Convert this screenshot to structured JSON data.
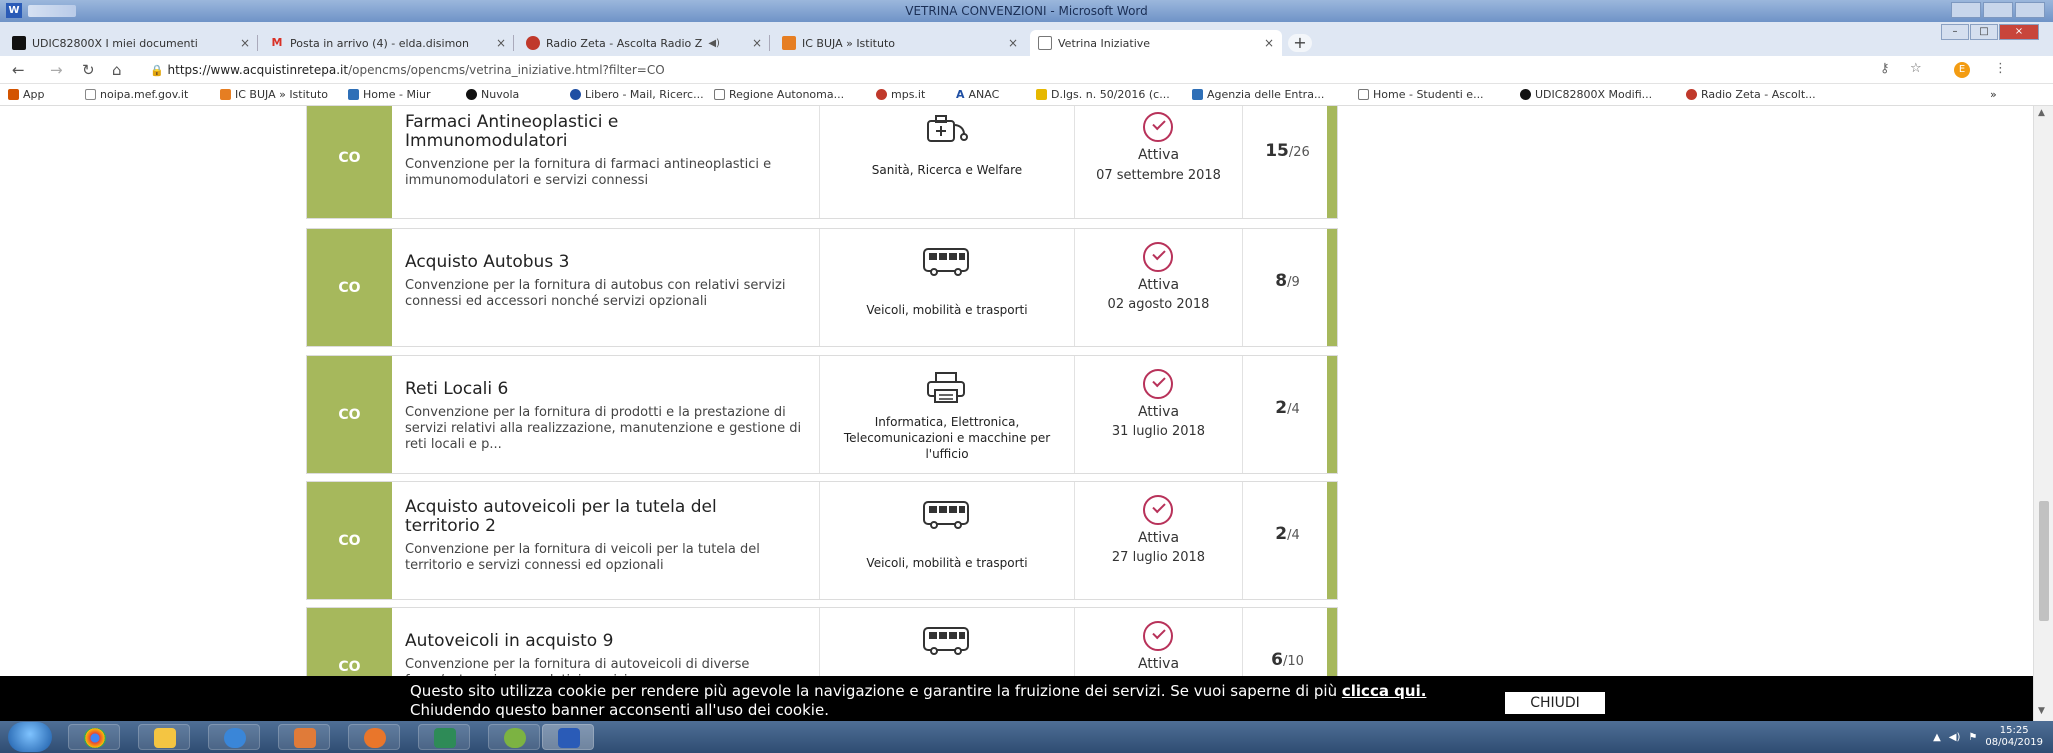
{
  "word": {
    "title": "VETRINA CONVENZIONI - Microsoft Word"
  },
  "tabs": [
    {
      "label": "UDIC82800X I miei documenti",
      "color": "#111111"
    },
    {
      "label": "Posta in arrivo (4) - elda.disimon",
      "color": "#d93025"
    },
    {
      "label": "Radio Zeta - Ascolta Radio Z",
      "color": "#c0392b"
    },
    {
      "label": "IC BUJA » Istituto",
      "color": "#e67e22"
    },
    {
      "label": "Vetrina Iniziative",
      "color": "#777777"
    }
  ],
  "address": {
    "domain": "https://www.acquistinretepa.it",
    "path": "/opencms/opencms/vetrina_iniziative.html?filter=CO"
  },
  "bookmarks": [
    {
      "label": "App",
      "color": "#d35400"
    },
    {
      "label": "noipa.mef.gov.it",
      "color": "#888888"
    },
    {
      "label": "IC BUJA » Istituto",
      "color": "#e67e22"
    },
    {
      "label": "Home - Miur",
      "color": "#2e6fb7"
    },
    {
      "label": "Nuvola",
      "color": "#111111"
    },
    {
      "label": "Libero - Mail, Ricerc...",
      "color": "#1f4fa3"
    },
    {
      "label": "Regione Autonoma...",
      "color": "#777777"
    },
    {
      "label": "mps.it",
      "color": "#c0392b"
    },
    {
      "label": "ANAC",
      "color": "#1f4fa3"
    },
    {
      "label": "D.lgs. n. 50/2016 (c...",
      "color": "#e6b800"
    },
    {
      "label": "Agenzia delle Entra...",
      "color": "#2e6fb7"
    },
    {
      "label": "Home - Studenti e...",
      "color": "#777777"
    },
    {
      "label": "UDIC82800X Modifi...",
      "color": "#111111"
    },
    {
      "label": "Radio Zeta - Ascolt...",
      "color": "#c0392b"
    }
  ],
  "initiatives": [
    {
      "code": "CO",
      "title": "Farmaci Antineoplastici e Immunomodulatori",
      "description": "Convenzione per la fornitura di farmaci antineoplastici e immunomodulatori e servizi connessi",
      "category": "Sanità, Ricerca e Welfare",
      "category_icon": "health-icon",
      "status": "Attiva",
      "date": "07 settembre 2018",
      "count": "15",
      "total": "/26"
    },
    {
      "code": "CO",
      "title": "Acquisto Autobus 3",
      "description": "Convenzione per la fornitura di autobus con relativi servizi connessi ed accessori nonché servizi opzionali",
      "category": "Veicoli, mobilità e trasporti",
      "category_icon": "bus-icon",
      "status": "Attiva",
      "date": "02 agosto 2018",
      "count": "8",
      "total": "/9"
    },
    {
      "code": "CO",
      "title": "Reti Locali 6",
      "description": "Convenzione per la fornitura di prodotti e la prestazione di servizi relativi alla realizzazione, manutenzione e gestione di reti locali e p...",
      "category": "Informatica, Elettronica, Telecomunicazioni e macchine per l'ufficio",
      "category_icon": "printer-icon",
      "status": "Attiva",
      "date": "31 luglio 2018",
      "count": "2",
      "total": "/4"
    },
    {
      "code": "CO",
      "title": "Acquisto autoveicoli per la tutela del territorio 2",
      "description": "Convenzione per la fornitura di veicoli per la tutela del territorio e servizi connessi ed opzionali",
      "category": "Veicoli, mobilità e trasporti",
      "category_icon": "bus-icon",
      "status": "Attiva",
      "date": "27 luglio 2018",
      "count": "2",
      "total": "/4"
    },
    {
      "code": "CO",
      "title": "Autoveicoli in acquisto 9",
      "description": "Convenzione per la fornitura di autoveicoli di diverse fasce/categorie con relativi servizi",
      "category": "",
      "category_icon": "bus-icon",
      "status": "Attiva",
      "date": "",
      "count": "6",
      "total": "/10"
    }
  ],
  "cookie": {
    "text1": "Questo sito utilizza cookie per rendere più agevole la navigazione e garantire la fruizione dei servizi. Se vuoi saperne di più",
    "link": "clicca qui.",
    "text2": "Chiudendo questo banner acconsenti all'uso dei cookie.",
    "button": "CHIUDI"
  },
  "taskbar": {
    "apps": [
      "start-button",
      "chrome-icon",
      "explorer-icon",
      "ie-icon",
      "users-icon",
      "media-icon",
      "excel-icon",
      "app-icon",
      "word-icon"
    ],
    "time": "15:25",
    "date": "08/04/2019"
  },
  "colors": {
    "accent": "#a6b85c",
    "status_check": "#b8325a"
  }
}
